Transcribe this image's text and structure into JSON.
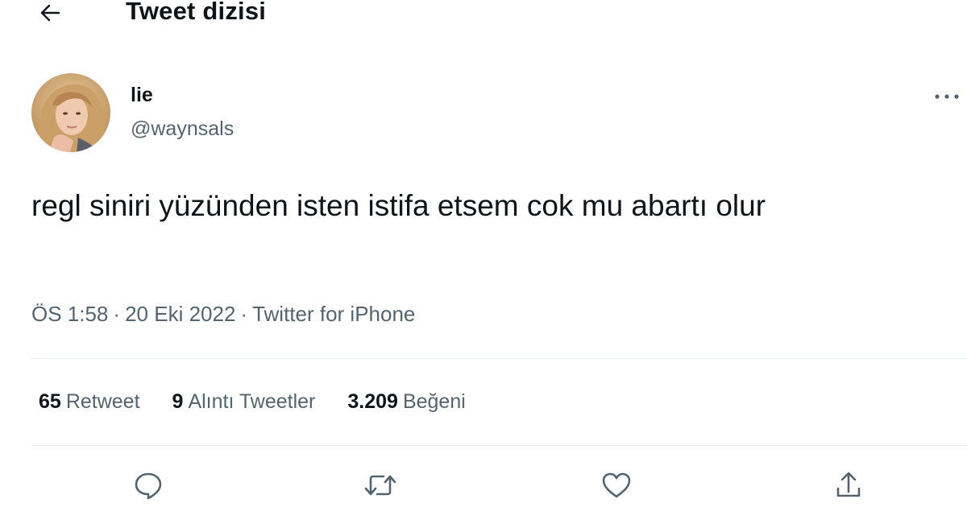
{
  "header": {
    "title": "Tweet dizisi",
    "back_icon": "arrow-left-icon"
  },
  "tweet": {
    "display_name": "lie",
    "handle": "@waynsals",
    "text": "regl siniri yüzünden isten istifa etsem cok mu abartı olur",
    "time": "ÖS 1:58",
    "date": "20 Eki 2022",
    "source": "Twitter for iPhone",
    "separator": "·",
    "more_icon": "more-horizontal-icon"
  },
  "stats": {
    "retweets": {
      "count": "65",
      "label": "Retweet"
    },
    "quotes": {
      "count": "9",
      "label": "Alıntı Tweetler"
    },
    "likes": {
      "count": "3.209",
      "label": "Beğeni"
    }
  },
  "actions": [
    "reply-icon",
    "retweet-icon",
    "like-icon",
    "share-icon"
  ],
  "colors": {
    "text_primary": "#0f1419",
    "text_secondary": "#536471",
    "divider": "#e6ecf0"
  }
}
